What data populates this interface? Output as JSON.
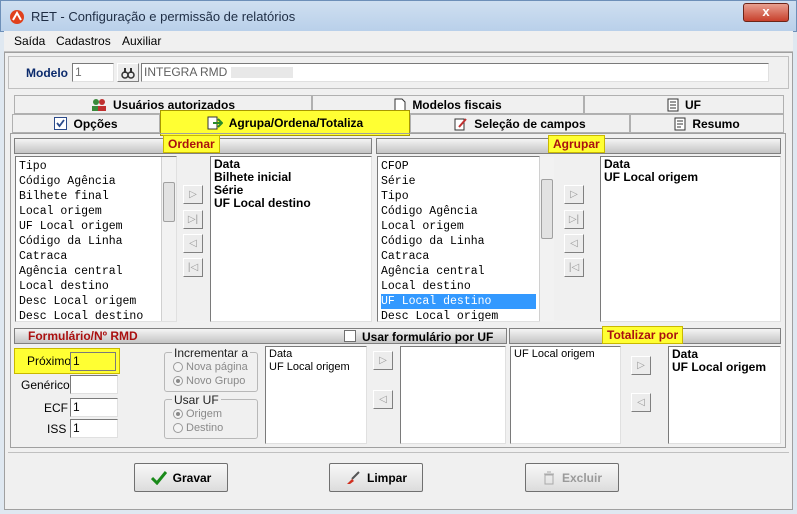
{
  "window": {
    "title": "RET - Configuração e permissão de relatórios",
    "close_label": "x"
  },
  "menu": [
    "Saída",
    "Cadastros",
    "Auxiliar"
  ],
  "modelo": {
    "label": "Modelo",
    "number": "1",
    "name": "INTEGRA RMD"
  },
  "tabs_row1": [
    "Usuários autorizados",
    "Modelos fiscais",
    "UF"
  ],
  "tabs_row2": [
    "Opções",
    "Agrupa/Ordena/Totaliza",
    "Seleção de campos",
    "Resumo"
  ],
  "ordenar": {
    "title": "Ordenar",
    "available": [
      "Tipo",
      "Código Agência",
      "Bilhete final",
      "Local origem",
      "UF Local origem",
      "Código da Linha",
      "Catraca",
      "Agência central",
      "Local destino",
      "Desc Local origem",
      "Desc Local destino"
    ],
    "selected": [
      "Data",
      "Bilhete inicial",
      "Série",
      "UF Local destino"
    ]
  },
  "agrupar": {
    "title": "Agrupar",
    "available": [
      "CFOP",
      "Série",
      "Tipo",
      "Código Agência",
      "Local origem",
      "Código da Linha",
      "Catraca",
      "Agência central",
      "Local destino",
      "UF Local destino",
      "Desc Local origem"
    ],
    "selected_available": "UF Local destino",
    "selected": [
      "Data",
      "UF Local origem"
    ]
  },
  "formulario": {
    "title": "Formulário/Nº RMD",
    "checkbox_label": "Usar formulário por UF",
    "proximo_label": "Próximo",
    "proximo_value": "1",
    "generico_label": "Genérico",
    "generico_value": "",
    "ecf_label": "ECF",
    "ecf_value": "1",
    "iss_label": "ISS",
    "iss_value": "1",
    "incrementar": {
      "title": "Incrementar a",
      "options": [
        "Nova página",
        "Novo Grupo"
      ],
      "selected": "Novo Grupo"
    },
    "usar_uf": {
      "title": "Usar UF",
      "options": [
        "Origem",
        "Destino"
      ],
      "selected": "Origem"
    },
    "available": [
      "Data",
      "UF Local origem"
    ],
    "selected": []
  },
  "totalizar": {
    "title": "Totalizar por",
    "available": [
      "UF Local origem"
    ],
    "selected": [
      "Data",
      "UF Local origem"
    ]
  },
  "buttons": {
    "gravar": "Gravar",
    "limpar": "Limpar",
    "excluir": "Excluir"
  },
  "colors": {
    "highlight": "#ffff33",
    "panel_title": "#aa1010",
    "selection": "#3399ff"
  }
}
